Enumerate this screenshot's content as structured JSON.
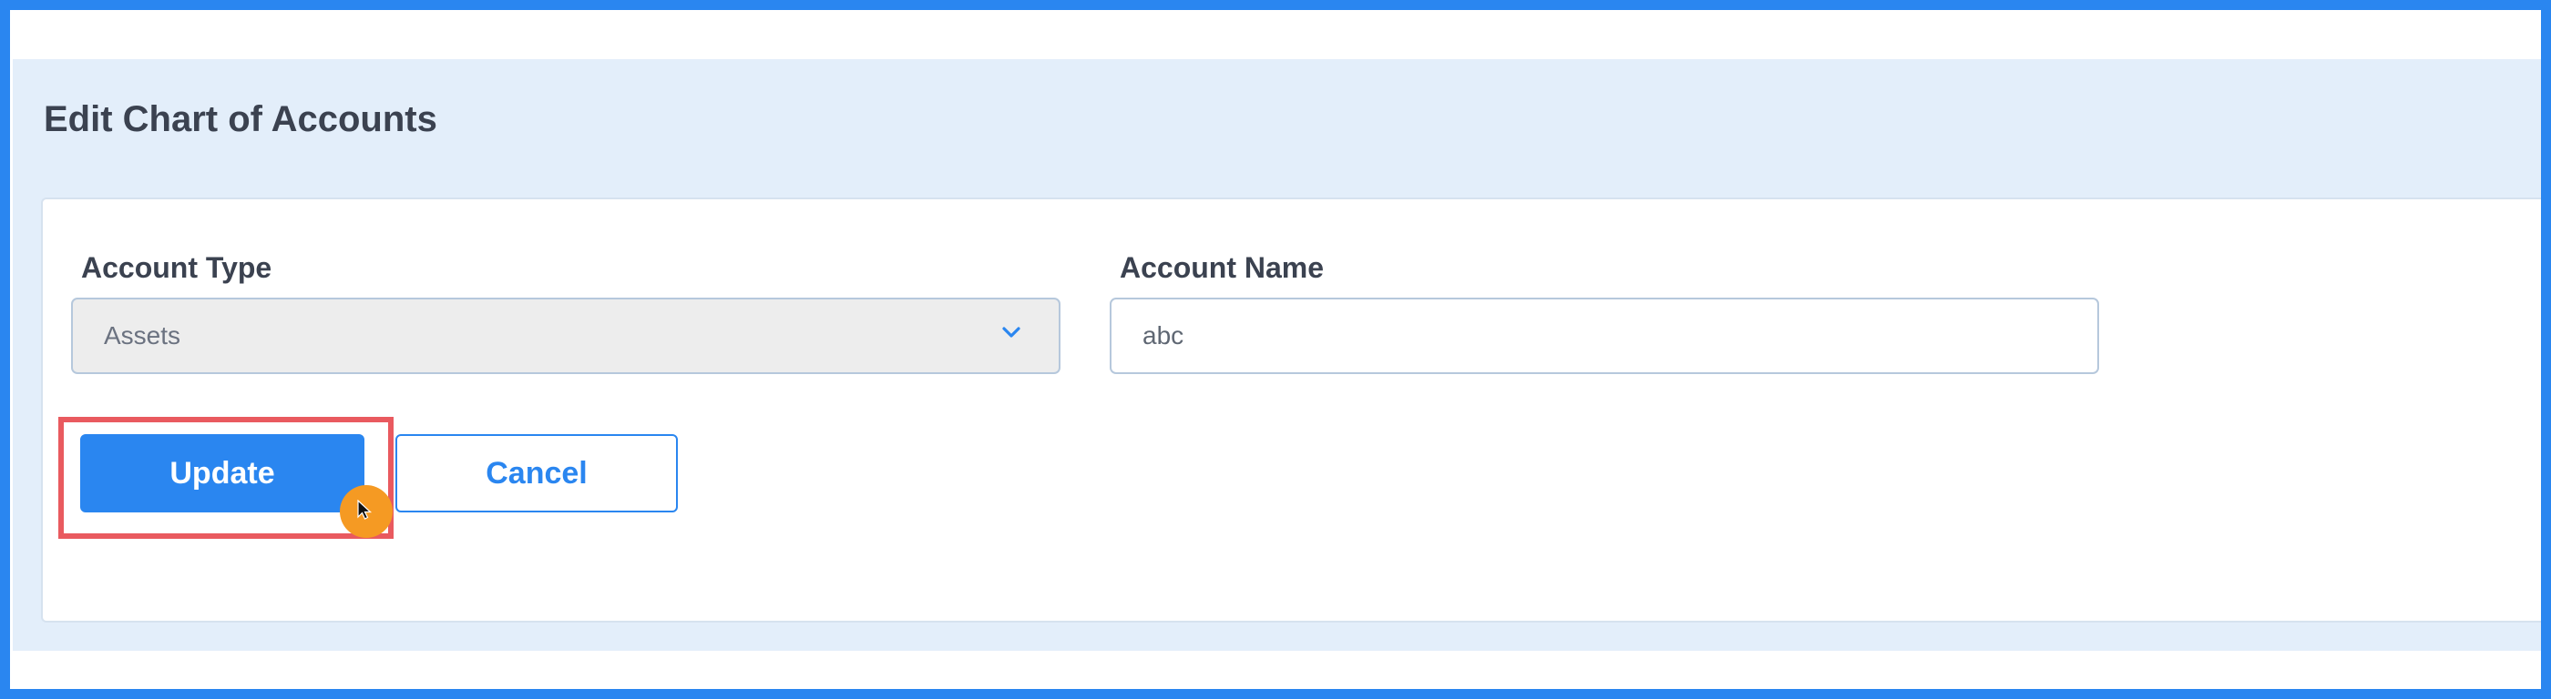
{
  "page": {
    "title": "Edit Chart of Accounts"
  },
  "form": {
    "account_type": {
      "label": "Account Type",
      "selected": "Assets"
    },
    "account_name": {
      "label": "Account Name",
      "value": "abc"
    }
  },
  "actions": {
    "update_label": "Update",
    "cancel_label": "Cancel"
  },
  "icons": {
    "select_arrow": "chevron-down-icon",
    "pointer": "mouse-cursor-icon"
  },
  "colors": {
    "accent": "#2a86f0",
    "header_background": "#e3eefa",
    "highlight": "#e95a5f",
    "cursor_marker": "#f59a23",
    "text_dark": "#3b4250"
  }
}
